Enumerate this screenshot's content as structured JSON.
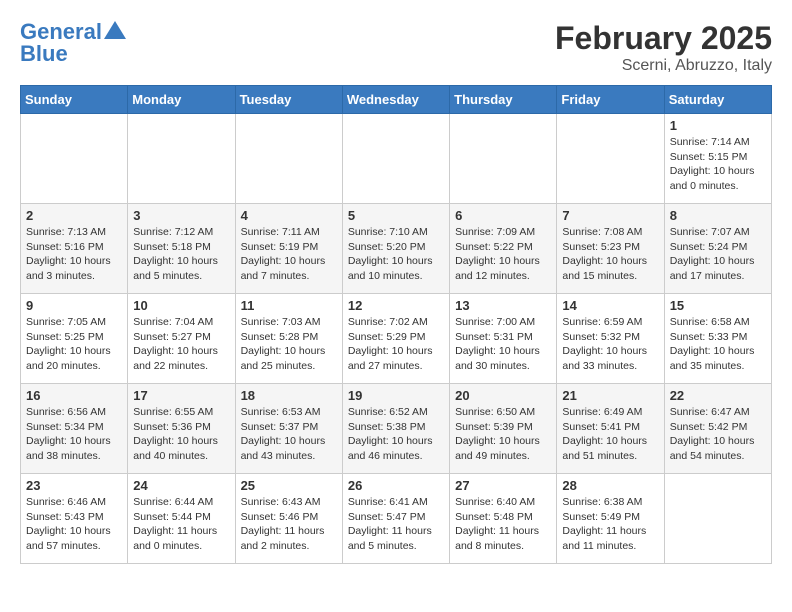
{
  "header": {
    "logo_line1": "General",
    "logo_line2": "Blue",
    "title": "February 2025",
    "subtitle": "Scerni, Abruzzo, Italy"
  },
  "days_of_week": [
    "Sunday",
    "Monday",
    "Tuesday",
    "Wednesday",
    "Thursday",
    "Friday",
    "Saturday"
  ],
  "weeks": [
    [
      {
        "day": "",
        "info": ""
      },
      {
        "day": "",
        "info": ""
      },
      {
        "day": "",
        "info": ""
      },
      {
        "day": "",
        "info": ""
      },
      {
        "day": "",
        "info": ""
      },
      {
        "day": "",
        "info": ""
      },
      {
        "day": "1",
        "info": "Sunrise: 7:14 AM\nSunset: 5:15 PM\nDaylight: 10 hours\nand 0 minutes."
      }
    ],
    [
      {
        "day": "2",
        "info": "Sunrise: 7:13 AM\nSunset: 5:16 PM\nDaylight: 10 hours\nand 3 minutes."
      },
      {
        "day": "3",
        "info": "Sunrise: 7:12 AM\nSunset: 5:18 PM\nDaylight: 10 hours\nand 5 minutes."
      },
      {
        "day": "4",
        "info": "Sunrise: 7:11 AM\nSunset: 5:19 PM\nDaylight: 10 hours\nand 7 minutes."
      },
      {
        "day": "5",
        "info": "Sunrise: 7:10 AM\nSunset: 5:20 PM\nDaylight: 10 hours\nand 10 minutes."
      },
      {
        "day": "6",
        "info": "Sunrise: 7:09 AM\nSunset: 5:22 PM\nDaylight: 10 hours\nand 12 minutes."
      },
      {
        "day": "7",
        "info": "Sunrise: 7:08 AM\nSunset: 5:23 PM\nDaylight: 10 hours\nand 15 minutes."
      },
      {
        "day": "8",
        "info": "Sunrise: 7:07 AM\nSunset: 5:24 PM\nDaylight: 10 hours\nand 17 minutes."
      }
    ],
    [
      {
        "day": "9",
        "info": "Sunrise: 7:05 AM\nSunset: 5:25 PM\nDaylight: 10 hours\nand 20 minutes."
      },
      {
        "day": "10",
        "info": "Sunrise: 7:04 AM\nSunset: 5:27 PM\nDaylight: 10 hours\nand 22 minutes."
      },
      {
        "day": "11",
        "info": "Sunrise: 7:03 AM\nSunset: 5:28 PM\nDaylight: 10 hours\nand 25 minutes."
      },
      {
        "day": "12",
        "info": "Sunrise: 7:02 AM\nSunset: 5:29 PM\nDaylight: 10 hours\nand 27 minutes."
      },
      {
        "day": "13",
        "info": "Sunrise: 7:00 AM\nSunset: 5:31 PM\nDaylight: 10 hours\nand 30 minutes."
      },
      {
        "day": "14",
        "info": "Sunrise: 6:59 AM\nSunset: 5:32 PM\nDaylight: 10 hours\nand 33 minutes."
      },
      {
        "day": "15",
        "info": "Sunrise: 6:58 AM\nSunset: 5:33 PM\nDaylight: 10 hours\nand 35 minutes."
      }
    ],
    [
      {
        "day": "16",
        "info": "Sunrise: 6:56 AM\nSunset: 5:34 PM\nDaylight: 10 hours\nand 38 minutes."
      },
      {
        "day": "17",
        "info": "Sunrise: 6:55 AM\nSunset: 5:36 PM\nDaylight: 10 hours\nand 40 minutes."
      },
      {
        "day": "18",
        "info": "Sunrise: 6:53 AM\nSunset: 5:37 PM\nDaylight: 10 hours\nand 43 minutes."
      },
      {
        "day": "19",
        "info": "Sunrise: 6:52 AM\nSunset: 5:38 PM\nDaylight: 10 hours\nand 46 minutes."
      },
      {
        "day": "20",
        "info": "Sunrise: 6:50 AM\nSunset: 5:39 PM\nDaylight: 10 hours\nand 49 minutes."
      },
      {
        "day": "21",
        "info": "Sunrise: 6:49 AM\nSunset: 5:41 PM\nDaylight: 10 hours\nand 51 minutes."
      },
      {
        "day": "22",
        "info": "Sunrise: 6:47 AM\nSunset: 5:42 PM\nDaylight: 10 hours\nand 54 minutes."
      }
    ],
    [
      {
        "day": "23",
        "info": "Sunrise: 6:46 AM\nSunset: 5:43 PM\nDaylight: 10 hours\nand 57 minutes."
      },
      {
        "day": "24",
        "info": "Sunrise: 6:44 AM\nSunset: 5:44 PM\nDaylight: 11 hours\nand 0 minutes."
      },
      {
        "day": "25",
        "info": "Sunrise: 6:43 AM\nSunset: 5:46 PM\nDaylight: 11 hours\nand 2 minutes."
      },
      {
        "day": "26",
        "info": "Sunrise: 6:41 AM\nSunset: 5:47 PM\nDaylight: 11 hours\nand 5 minutes."
      },
      {
        "day": "27",
        "info": "Sunrise: 6:40 AM\nSunset: 5:48 PM\nDaylight: 11 hours\nand 8 minutes."
      },
      {
        "day": "28",
        "info": "Sunrise: 6:38 AM\nSunset: 5:49 PM\nDaylight: 11 hours\nand 11 minutes."
      },
      {
        "day": "",
        "info": ""
      }
    ]
  ]
}
